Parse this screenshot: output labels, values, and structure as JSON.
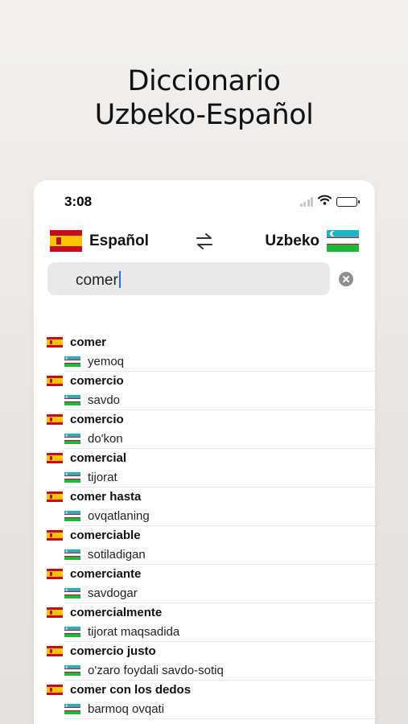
{
  "headline": {
    "line1": "Diccionario",
    "line2": "Uzbeko-Español"
  },
  "status_bar": {
    "time": "3:08"
  },
  "language_bar": {
    "from_label": "Español",
    "to_label": "Uzbeko"
  },
  "search": {
    "value": "comer"
  },
  "results": [
    {
      "es": "comer",
      "uz": "yemoq"
    },
    {
      "es": "comercio",
      "uz": "savdo"
    },
    {
      "es": "comercio",
      "uz": "do'kon"
    },
    {
      "es": "comercial",
      "uz": "tijorat"
    },
    {
      "es": "comer hasta",
      "uz": "ovqatlaning"
    },
    {
      "es": "comerciable",
      "uz": "sotiladigan"
    },
    {
      "es": "comerciante",
      "uz": "savdogar"
    },
    {
      "es": "comercialmente",
      "uz": "tijorat maqsadida"
    },
    {
      "es": "comercio justo",
      "uz": "o'zaro foydali savdo-sotiq"
    },
    {
      "es": "comer con los dedos",
      "uz": "barmoq ovqati"
    }
  ],
  "icons": {
    "swap": "swap-arrows-icon",
    "clear": "clear-circle-icon",
    "wifi": "wifi-icon",
    "signal": "cellular-signal-icon",
    "battery": "battery-icon"
  },
  "colors": {
    "caret": "#1a73e8",
    "search_bg": "#e9e9ea",
    "background": "#eeedeb"
  }
}
